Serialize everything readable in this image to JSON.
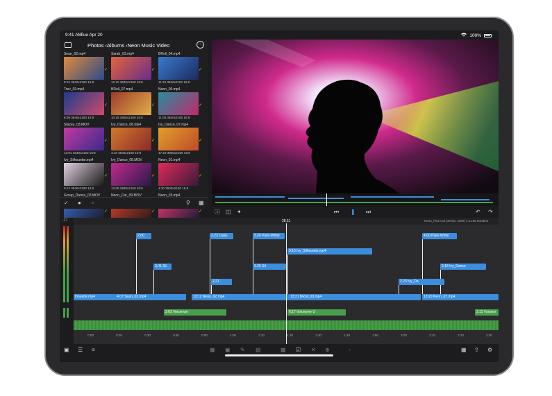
{
  "status_bar": {
    "time": "9:41 AM",
    "date": "Tue Apr 20",
    "battery": "100%"
  },
  "browser": {
    "path": "Photos ‹Albums ‹Neon Music Video",
    "tiles": [
      {
        "name": "Sean_02.mp4",
        "meta": "8:12 3840x2160 16:9",
        "colors": [
          "#e08a3a",
          "#2c4b8c"
        ]
      },
      {
        "name": "Sarah_03.mp4",
        "meta": "12:15 3840x2160 16:9",
        "colors": [
          "#e0653a",
          "#6b2c8c"
        ]
      },
      {
        "name": "BRoll_04.mp4",
        "meta": "11:10 3840x2160 16:9",
        "colors": [
          "#3a7ad0",
          "#1c2a5c"
        ]
      },
      {
        "name": "Trev_03.mp4",
        "meta": "8:09 3840x2160 16:9",
        "colors": [
          "#1c3c8c",
          "#d04a6a"
        ]
      },
      {
        "name": "BRoll_07.mp4",
        "meta": "10:18 3840x2160 16:9",
        "colors": [
          "#a03a2a",
          "#e0b04a"
        ]
      },
      {
        "name": "Neon_06.mp4",
        "meta": "11:08 3840x2160 16:9",
        "colors": [
          "#2a8ca0",
          "#c02a6a"
        ]
      },
      {
        "name": "Stacey_03.MOV",
        "meta": "13:01 3840x2160 16:9",
        "colors": [
          "#c03aa0",
          "#3a2a8c"
        ]
      },
      {
        "name": "Ivy_Dance_08.mp4",
        "meta": "4:10 3840x2160 16:9",
        "colors": [
          "#d07a2a",
          "#8c2a2a"
        ]
      },
      {
        "name": "Ivy_Dance_07.mp4",
        "meta": "17:23 3840x2160 16:9",
        "colors": [
          "#e0a02a",
          "#c04a2a"
        ]
      },
      {
        "name": "Ivy_Silhouette.mp4",
        "meta": "9:12 3840x2160 16:9",
        "colors": [
          "#e0d0e0",
          "#1a1a1a"
        ]
      },
      {
        "name": "Ivy_Dance_08.MOV",
        "meta": "12:08 3840x2160 16:9",
        "colors": [
          "#c02a8c",
          "#2a1a4a"
        ]
      },
      {
        "name": "Neon_01.mp4",
        "meta": "4:30 3840x2160 16:9",
        "colors": [
          "#e02a5a",
          "#3a1a3a"
        ]
      },
      {
        "name": "Group_Dance_03.MOV",
        "meta": "",
        "colors": [
          "#3a6ac0",
          "#1a1a2a"
        ]
      },
      {
        "name": "Neon_Car_09.MOV",
        "meta": "",
        "colors": [
          "#d0402a",
          "#2a1a1a"
        ]
      },
      {
        "name": "Neon_03.mp4",
        "meta": "",
        "colors": [
          "#e03a6a",
          "#1a1a3a"
        ]
      }
    ]
  },
  "timeline": {
    "level_marker": "-27",
    "playhead": "28.11",
    "project_info": "Neon_Fine Cut (30 fps, SDR) 1:11.05 duration",
    "ruler_ticks": [
      "0:00",
      "0:20",
      "0:30",
      "0:40",
      "0:50",
      "1:00",
      "1:10",
      "1:20",
      "1:30",
      "1:40",
      "1:50",
      "2:00",
      "2:10",
      "2:20",
      "2:30"
    ],
    "connected_clips": [
      {
        "label": "2.00",
        "color": "blue"
      },
      {
        "label": "2.23  Class",
        "color": "blue"
      },
      {
        "label": "3.20  Plain-White",
        "color": "blue"
      },
      {
        "label": "4.00  Plain-White",
        "color": "blue"
      },
      {
        "label": "9:15  Ivy_Silhouette.mp4",
        "color": "blue"
      },
      {
        "label": "3.01  Sli",
        "color": "blue"
      },
      {
        "label": "3.20  Sil",
        "color": "blue"
      },
      {
        "label": "3.18  Ivy_Dance",
        "color": "blue"
      },
      {
        "label": "2.21",
        "color": "blue"
      },
      {
        "label": "2.23  Ivy_Da",
        "color": "blue"
      }
    ],
    "primary_clips": [
      {
        "label": "lhouette.mp4"
      },
      {
        "label": "4.07  Sean_02.mp4"
      },
      {
        "label": "13:12  Neon_02.mp4"
      },
      {
        "label": "13:21  BRoll_03.mp4"
      },
      {
        "label": "13:20  Neon_07.mp4"
      }
    ],
    "audio_clips": [
      {
        "label": "2:03  Voiceover"
      },
      {
        "label": "6:17  Voiceover-3"
      },
      {
        "label": "3.11  Voiceov"
      }
    ]
  },
  "colors": {
    "accent_blue": "#3c8ddc",
    "accent_green": "#4aa04a",
    "check_yellow": "#f5c400"
  }
}
